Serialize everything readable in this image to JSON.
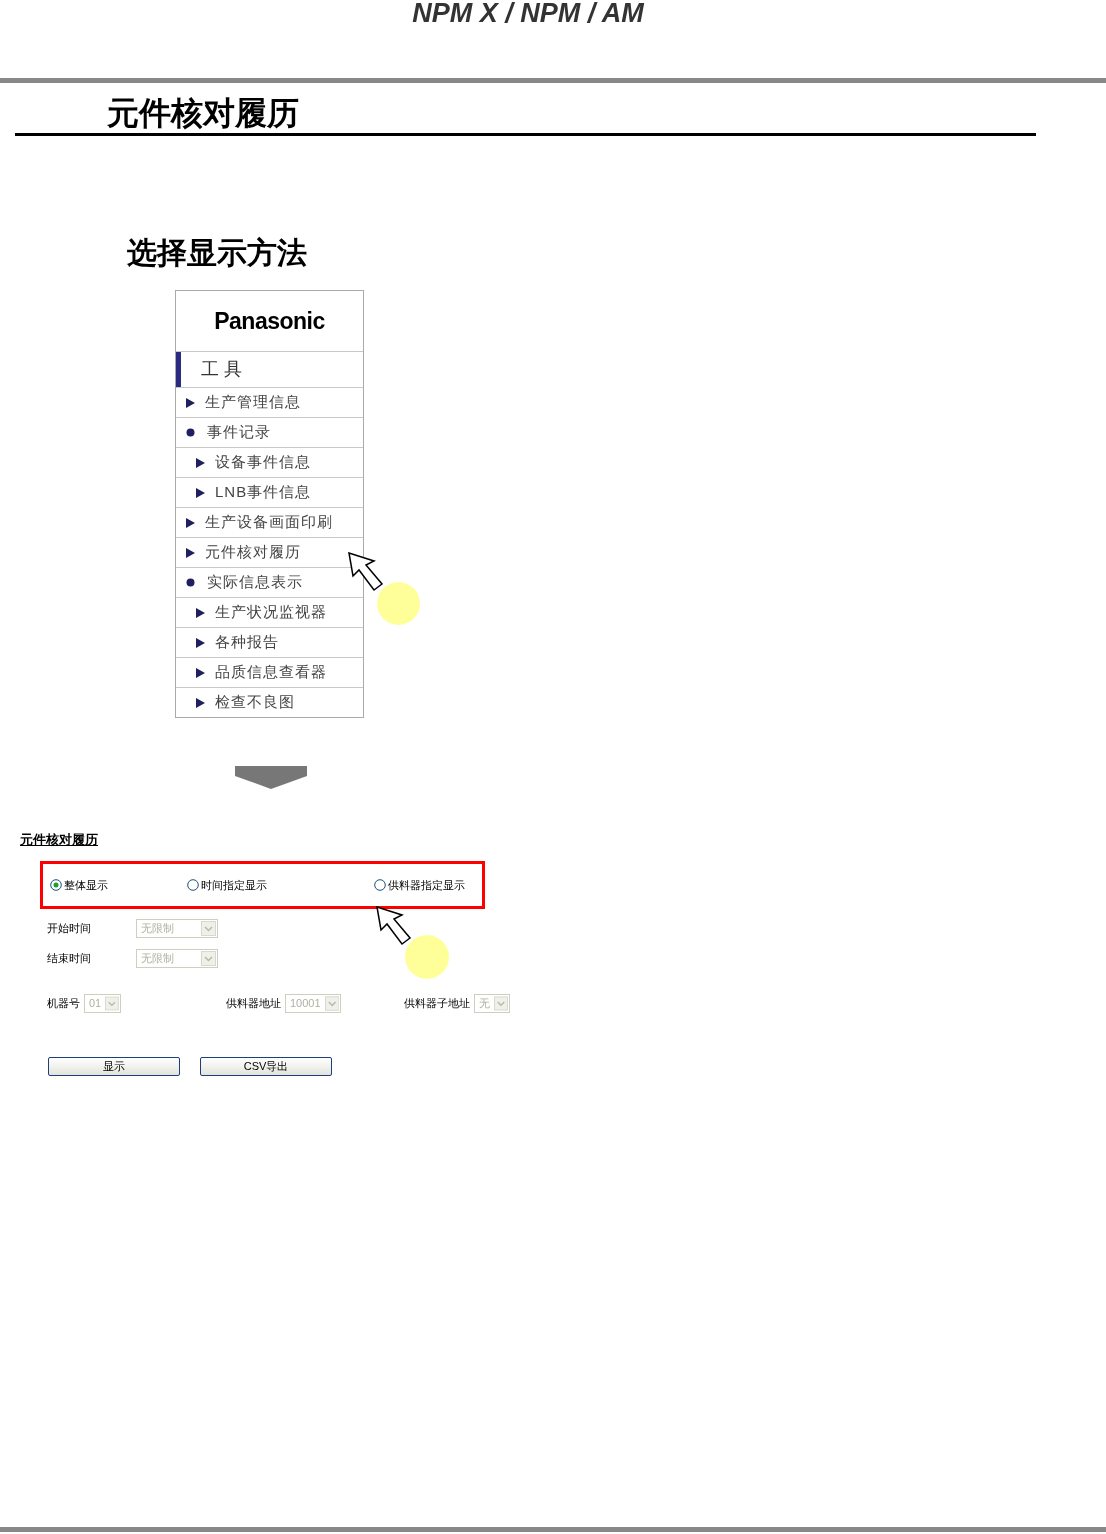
{
  "header": {
    "title": "NPM X / NPM / AM"
  },
  "section_title": "元件核对履历",
  "step_title": "选择显示方法",
  "menu": {
    "logo": "Panasonic",
    "heading": "工 具",
    "items": [
      {
        "label": "生产管理信息"
      },
      {
        "label": "事件记录",
        "children": [
          {
            "label": "设备事件信息"
          },
          {
            "label": "LNB事件信息"
          }
        ]
      },
      {
        "label": "生产设备画面印刷"
      },
      {
        "label": "元件核对履历"
      },
      {
        "label": "实际信息表示",
        "children": [
          {
            "label": "生产状况监视器"
          },
          {
            "label": "各种报告"
          },
          {
            "label": "品质信息查看器"
          },
          {
            "label": "检查不良图"
          }
        ]
      }
    ]
  },
  "form": {
    "title": "元件核对履历",
    "display_modes": [
      {
        "label": "整体显示",
        "selected": true
      },
      {
        "label": "时间指定显示",
        "selected": false
      },
      {
        "label": "供料器指定显示",
        "selected": false
      }
    ],
    "time_fields": [
      {
        "label": "开始时间",
        "value": "无限制",
        "disabled": true
      },
      {
        "label": "结束时间",
        "value": "无限制",
        "disabled": true
      }
    ],
    "filters": [
      {
        "label": "机器号",
        "value": "01",
        "disabled": true
      },
      {
        "label": "供料器地址",
        "value": "10001",
        "disabled": true
      },
      {
        "label": "供料器子地址",
        "value": "无",
        "disabled": true
      }
    ],
    "buttons": [
      "显示",
      "CSV导出"
    ]
  }
}
